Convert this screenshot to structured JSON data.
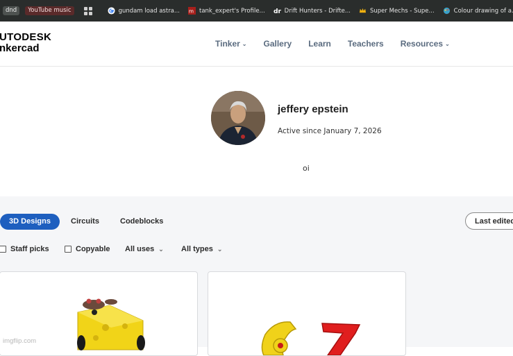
{
  "bookmarks": {
    "chip1": "dnd",
    "chip2": "YouTube music",
    "items": [
      {
        "label": "gundam load astra...",
        "icon": "google-icon"
      },
      {
        "label": "tank_expert's Profile...",
        "icon": "im-icon"
      },
      {
        "label": "Drift Hunters - Drifte...",
        "icon": "dr-icon"
      },
      {
        "label": "Super Mechs - Supe...",
        "icon": "crown-icon"
      },
      {
        "label": "Colour drawing of a...",
        "icon": "palette-icon"
      }
    ]
  },
  "header": {
    "logo_line1": "UTODESK",
    "logo_line2": "nkercad",
    "nav": [
      "Tinker",
      "Gallery",
      "Learn",
      "Teachers",
      "Resources"
    ]
  },
  "profile": {
    "name": "jeffery epstein",
    "active_since": "Active since January 7, 2026",
    "bio": "oi"
  },
  "tabs": {
    "designs": "3D Designs",
    "circuits": "Circuits",
    "codeblocks": "Codeblocks",
    "sort": "Last edited"
  },
  "filters": {
    "staff_picks": "Staff picks",
    "copyable": "Copyable",
    "uses": "All uses",
    "types": "All types"
  },
  "watermark": "imgflip.com",
  "colors": {
    "accent": "#1e5fbf",
    "bookmark_bar": "#2a2d2c"
  }
}
